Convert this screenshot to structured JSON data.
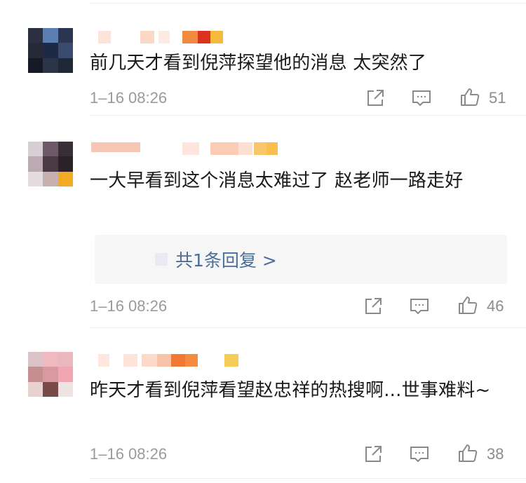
{
  "comments": [
    {
      "text": "前几天才看到倪萍探望他的消息 太突然了",
      "time": "1–16 08:26",
      "likes": "51",
      "reply_link": null
    },
    {
      "text": "一大早看到这个消息太难过了 赵老师一路走好",
      "time": "1–16 08:26",
      "likes": "46",
      "reply_link": "共1条回复 >"
    },
    {
      "text": "昨天才看到倪萍看望赵忠祥的热搜啊...世事难料~",
      "time": "1–16 08:26",
      "likes": "38",
      "reply_link": null
    }
  ],
  "icons": {
    "share": "share-icon",
    "comment": "comment-icon",
    "like": "thumbs-up-icon"
  },
  "colors": {
    "text": "#1a1a1a",
    "meta": "#9a9a9a",
    "link": "#4a6e9c",
    "reply_bg": "#f6f6f6",
    "divider": "#ececec"
  }
}
